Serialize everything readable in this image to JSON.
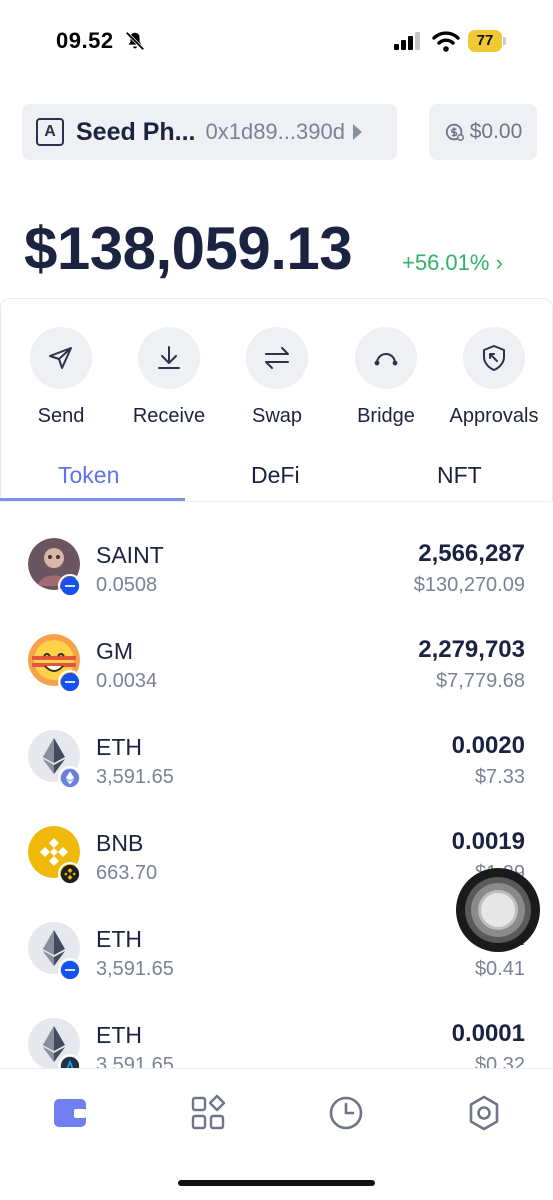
{
  "status_bar": {
    "time": "09.52",
    "battery": "77"
  },
  "account": {
    "avatar_letter": "A",
    "name": "Seed Ph...",
    "address": "0x1d89...390d"
  },
  "gas": {
    "value": "$0.00"
  },
  "portfolio": {
    "total": "$138,059.13",
    "change": "+56.01% ›"
  },
  "actions": [
    {
      "label": "Send",
      "icon": "send-icon"
    },
    {
      "label": "Receive",
      "icon": "receive-icon"
    },
    {
      "label": "Swap",
      "icon": "swap-icon"
    },
    {
      "label": "Bridge",
      "icon": "bridge-icon"
    },
    {
      "label": "Approvals",
      "icon": "shield-icon"
    }
  ],
  "tabs": [
    {
      "label": "Token",
      "active": true
    },
    {
      "label": "DeFi",
      "active": false
    },
    {
      "label": "NFT",
      "active": false
    }
  ],
  "tokens": [
    {
      "symbol": "SAINT",
      "price": "0.0508",
      "amount": "2,566,287",
      "value": "$130,270.09",
      "logo": "saint-logo",
      "chain": "base-chain-badge"
    },
    {
      "symbol": "GM",
      "price": "0.0034",
      "amount": "2,279,703",
      "value": "$7,779.68",
      "logo": "gm-logo",
      "chain": "base-chain-badge"
    },
    {
      "symbol": "ETH",
      "price": "3,591.65",
      "amount": "0.0020",
      "value": "$7.33",
      "logo": "eth-logo",
      "chain": "ethereum-chain-badge"
    },
    {
      "symbol": "BNB",
      "price": "663.70",
      "amount": "0.0019",
      "value": "$1.29",
      "logo": "bnb-logo",
      "chain": "bnb-chain-badge"
    },
    {
      "symbol": "ETH",
      "price": "3,591.65",
      "amount": "0.",
      "value": "$0.41",
      "logo": "eth-logo",
      "chain": "base-chain-badge"
    },
    {
      "symbol": "ETH",
      "price": "3,591.65",
      "amount": "0.0001",
      "value": "$0.32",
      "logo": "eth-logo",
      "chain": "arbitrum-chain-badge"
    }
  ],
  "bottom_nav": [
    {
      "name": "wallet-icon",
      "active": true
    },
    {
      "name": "apps-icon",
      "active": false
    },
    {
      "name": "history-icon",
      "active": false
    },
    {
      "name": "settings-icon",
      "active": false
    }
  ],
  "colors": {
    "accent": "#5f72e6",
    "positive": "#2eb368",
    "text": "#1b2340",
    "muted": "#7b8295",
    "surface": "#eef0f4"
  }
}
